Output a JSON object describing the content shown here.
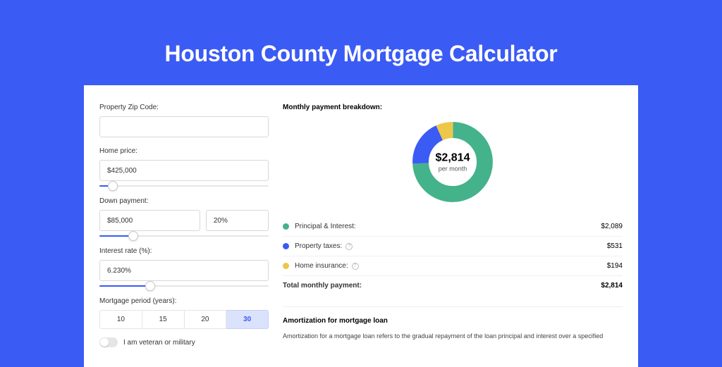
{
  "page": {
    "title": "Houston County Mortgage Calculator"
  },
  "form": {
    "zip_label": "Property Zip Code:",
    "zip_value": "",
    "price_label": "Home price:",
    "price_value": "$425,000",
    "price_slider_pct": 8,
    "down_label": "Down payment:",
    "down_value": "$85,000",
    "down_pct": "20%",
    "down_slider_pct": 20,
    "rate_label": "Interest rate (%):",
    "rate_value": "6.230%",
    "rate_slider_pct": 30,
    "period_label": "Mortgage period (years):",
    "periods": [
      "10",
      "15",
      "20",
      "30"
    ],
    "period_selected": "30",
    "veteran_label": "I am veteran or military"
  },
  "breakdown": {
    "title": "Monthly payment breakdown:",
    "total_value": "$2,814",
    "total_sub": "per month",
    "items": [
      {
        "key": "pi",
        "label": "Principal & Interest:",
        "value": "$2,089",
        "color": "#44b28b",
        "amount": 2089
      },
      {
        "key": "tax",
        "label": "Property taxes:",
        "value": "$531",
        "color": "#3b5bf5",
        "amount": 531,
        "info": true
      },
      {
        "key": "ins",
        "label": "Home insurance:",
        "value": "$194",
        "color": "#edc74a",
        "amount": 194,
        "info": true
      }
    ],
    "total_label": "Total monthly payment:",
    "total_amount": "$2,814"
  },
  "amort": {
    "title": "Amortization for mortgage loan",
    "text": "Amortization for a mortgage loan refers to the gradual repayment of the loan principal and interest over a specified"
  },
  "chart_data": {
    "type": "pie",
    "title": "Monthly payment breakdown",
    "categories": [
      "Principal & Interest",
      "Property taxes",
      "Home insurance"
    ],
    "values": [
      2089,
      531,
      194
    ],
    "colors": [
      "#44b28b",
      "#3b5bf5",
      "#edc74a"
    ],
    "center_label": "$2,814 per month",
    "donut": true
  }
}
